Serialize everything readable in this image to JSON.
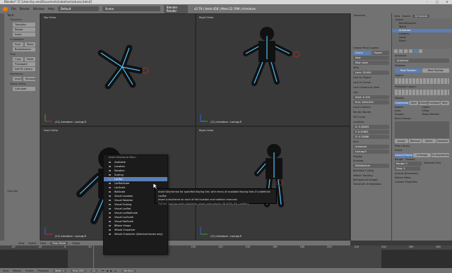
{
  "window": {
    "title": "Blender* [C:\\Users\\ky-ono\\Documents\\robot\\armatures.blend]",
    "controls": [
      "–",
      "□",
      "✕"
    ]
  },
  "topbar": {
    "menus": [
      "File",
      "Render",
      "Window",
      "Help"
    ],
    "layout": "Default",
    "scene": "Scene",
    "engine": "Blender Render",
    "stats": "v2.79 | Verts:458 | Mem:22.76M | Armature"
  },
  "toolshelf": {
    "header": "Tools",
    "section_transform": "Transform",
    "translate": "Translate",
    "rotate": "Rotate",
    "scale": "Scale",
    "section_inbetween": "In-Between",
    "push": "Push",
    "relax": "Relax",
    "breakdowner": "Breakdowner",
    "section_pose": "Pose",
    "copy": "Copy",
    "paste": "Paste",
    "propagate": "Propagate",
    "add_to_library": "Add To Library",
    "section_keyframes": "Keyframes",
    "insert": "Insert",
    "remove": "Remove",
    "section_motion_paths": "Motion Paths",
    "calculate": "Calculate",
    "operator": "Operator"
  },
  "viewports": {
    "tl_label": "Top Ortho",
    "tr_label": "Right Ortho",
    "bl_label": "Front Ortho",
    "br_label": "Right Ortho",
    "status_tl": "(11) Armature : LocLeg.R",
    "status_tr": "(11) Armature : LocLeg.R",
    "status_bl": "(11) Armature : LocLeg.R",
    "status_br": "(11) Armature : LocLeg.R"
  },
  "viewport_header": {
    "view": "View",
    "select": "Select",
    "pose": "Pose",
    "mode": "Pose Mode",
    "pivot": "Global"
  },
  "context_menu": {
    "title": "Insert Keyframe Menu",
    "items": [
      "Available",
      "Location",
      "Rotation",
      "Scaling",
      "LocRot",
      "LocRotScale",
      "LocScale",
      "RotScale",
      "Visual Location",
      "Visual Rotation",
      "Visual Scaling",
      "Visual LocRot",
      "Visual LocRotScale",
      "Visual LocScale",
      "Visual RotScale",
      "BBone Shape",
      "Whole Character",
      "Whole Character (Selected bones only)"
    ],
    "selected_index": 4
  },
  "tooltip": {
    "line1": "Insert Keyframes for specified Keying Set, with menu of available Keying Sets if undefined:  LocRot",
    "line2": "Insert a keyframe on each of the location and rotation channels",
    "line3": "Python: bpy.ops.anim.keyframe_insert_menu(type='BUILTIN_KSI_LocRot')"
  },
  "npanel": {
    "section_transform": "Transform",
    "section_grease": "Grease Pencil Layers",
    "scene": "Scene",
    "object": "Object",
    "new": "New",
    "new_layer": "New Layer",
    "section_view": "View",
    "lens_label": "Lens:",
    "lens_value": "35.000",
    "lock_to_object": "Lock to Object:",
    "lock_to_cursor": "Lock to Cursor",
    "lock_camera": "Lock Camera to View",
    "clip": "Clip:",
    "clip_start": "Start:",
    "clip_start_value": "0.100",
    "clip_end": "End:",
    "clip_end_value": "1000.000",
    "local_camera": "Local Camera:",
    "render_border": "Render Border",
    "section_cursor": "3D Cursor",
    "location": "Location:",
    "x_label": "X:",
    "x_value": "0.38883",
    "y_label": "Y:",
    "y_value": "0.42685",
    "z_label": "Z:",
    "z_value": "0.70886",
    "section_item": "Item",
    "item_name": "Armature",
    "bone_name": "LocLeg.R",
    "section_display": "Display",
    "section_shading": "Shading",
    "shading_mode": "Multitexture",
    "backface": "Backface Culling",
    "motion_tracking": "Motion Tracking",
    "background_images": "Background Images",
    "transform_orientations": "Transform Orientations"
  },
  "outliner": {
    "view": "View",
    "search": "Search",
    "filter": "All Scenes",
    "items": [
      "Scene",
      "RenderLayers",
      "World",
      "Armature",
      "Camera",
      "Lamp",
      "Plane"
    ]
  },
  "properties": {
    "breadcrumb": "Armature",
    "name": "Armature",
    "section_skeleton": "Skeleton",
    "pose_position": "Pose Position",
    "rest_position": "Rest Position",
    "layers": "Layers:",
    "protected_layers": "Protected Layers:",
    "section_display": "Display",
    "octahedral": "Octahedral",
    "stick": "Stick",
    "bbone": "B-Bone",
    "envelope": "Envelope",
    "wire": "Wire",
    "names": "Names",
    "colors": "Colors",
    "axes": "Axes",
    "xray": "X-Ray",
    "shapes": "Shapes",
    "delay_refresh": "Delay Refresh",
    "section_bone_groups": "Bone Groups",
    "assign": "Assign",
    "remove": "Remove",
    "select": "Select",
    "deselect": "Deselect",
    "section_pose_library": "Pose Library",
    "section_ghost": "Ghost",
    "around_frame": "Around Frame",
    "in_range": "In Range",
    "on_keyframes": "On Keyframes",
    "range_label": "Range:",
    "range_value": "0",
    "display_label": "Display:",
    "step_label": "Step:",
    "step_value": "1",
    "selected_only": "Selected Only",
    "section_inverse_kinematics": "Inverse Kinematics",
    "section_motion_paths": "Motion Paths",
    "section_custom_properties": "Custom Properties"
  },
  "timeline": {
    "view": "View",
    "marker": "Marker",
    "frame": "Frame",
    "playback": "Playback",
    "start_label": "Start:",
    "start_value": "1",
    "end_label": "End:",
    "end_value": "250",
    "current": "11",
    "sync": "No Sync",
    "ticks": [
      "-40",
      "-20",
      "0",
      "20",
      "40",
      "60",
      "80",
      "100",
      "120",
      "140",
      "160",
      "180",
      "200",
      "220",
      "240",
      "260",
      "280"
    ]
  },
  "colors": {
    "selection_blue": "#5a7fb5",
    "bone_cyan": "#4fc3ff",
    "axis_red": "#c03030",
    "axis_green": "#3aa03a"
  }
}
